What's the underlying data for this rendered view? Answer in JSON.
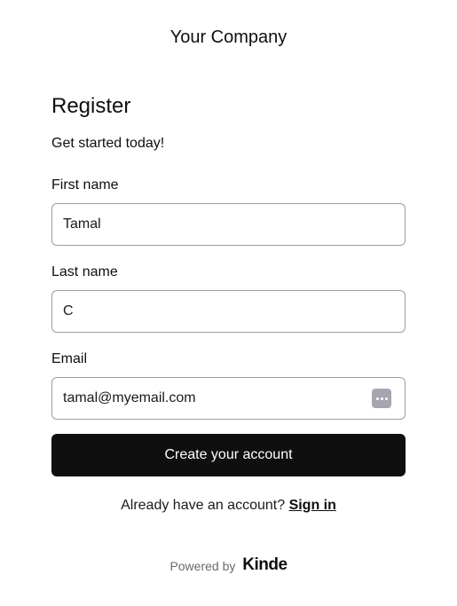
{
  "header": {
    "company_name": "Your Company"
  },
  "form": {
    "title": "Register",
    "subtitle": "Get started today!",
    "first_name": {
      "label": "First name",
      "value": "Tamal"
    },
    "last_name": {
      "label": "Last name",
      "value": "C"
    },
    "email": {
      "label": "Email",
      "value": "tamal@myemail.com",
      "autofill_icon": "password-manager-icon"
    },
    "submit_label": "Create your account"
  },
  "signin": {
    "prompt": "Already have an account?",
    "link_label": "Sign in"
  },
  "footer": {
    "powered_by": "Powered by",
    "brand": "Kinde"
  },
  "colors": {
    "button_bg": "#0f0f0f",
    "input_border": "#9e9e9e",
    "muted_text": "#6b6b6b",
    "autofill_icon_bg": "#a6a6b0"
  }
}
